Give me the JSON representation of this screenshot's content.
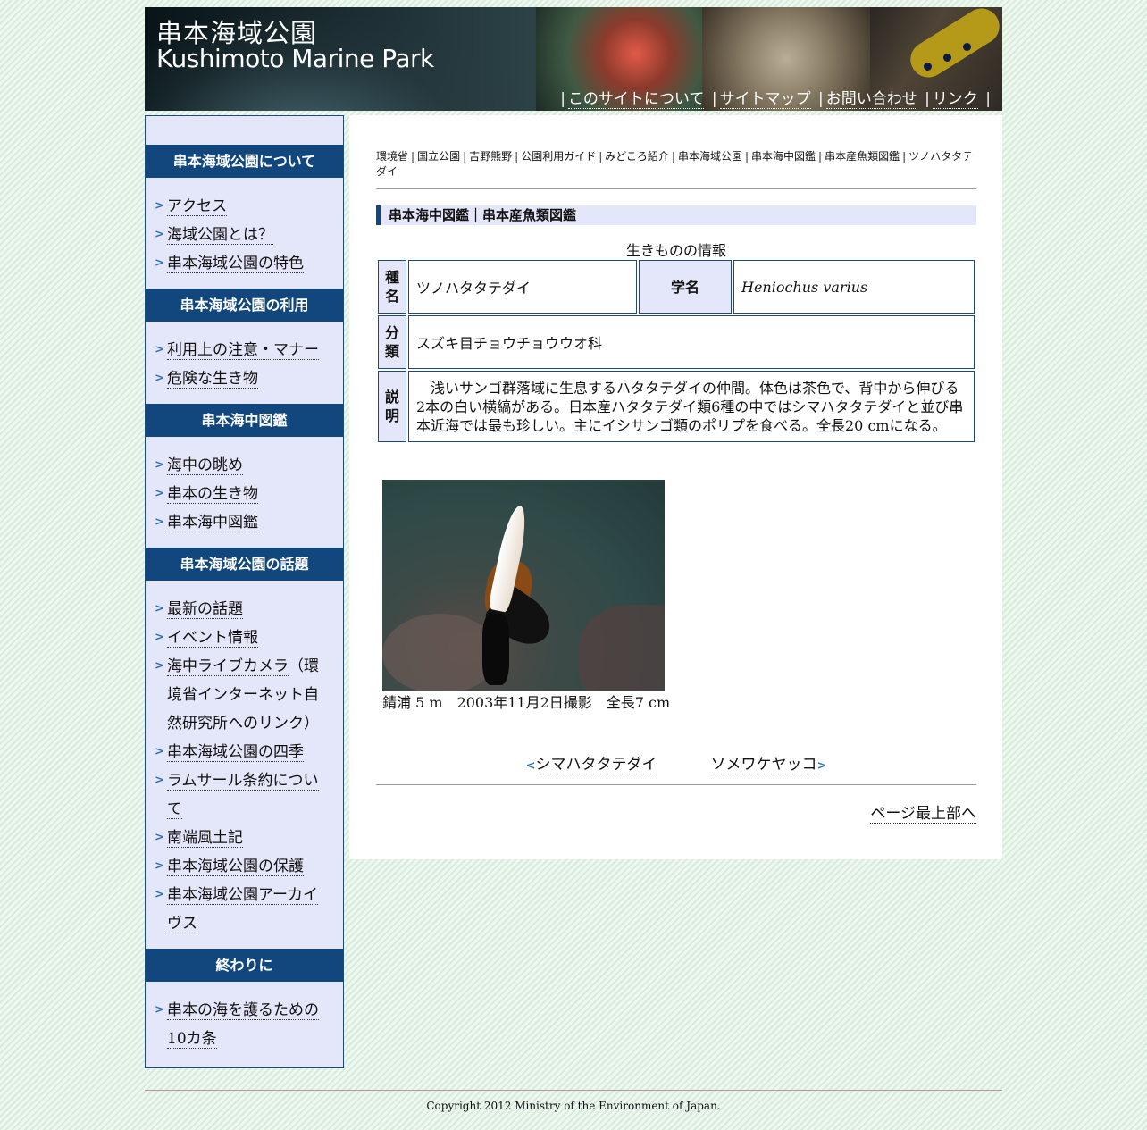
{
  "header": {
    "title_ja": "串本海域公園",
    "title_en": "Kushimoto Marine Park",
    "nav": [
      "このサイトについて",
      "サイトマップ",
      "お問い合わせ",
      "リンク"
    ]
  },
  "sidebar": {
    "sections": [
      {
        "title": "串本海域公園について",
        "items": [
          "アクセス",
          "海域公園とは？",
          "串本海域公園の特色"
        ]
      },
      {
        "title": "串本海域公園の利用",
        "items": [
          "利用上の注意・マナー",
          "危険な生き物"
        ]
      },
      {
        "title": "串本海中図鑑",
        "items": [
          "海中の眺め",
          "串本の生き物",
          "串本海中図鑑"
        ]
      },
      {
        "title": "串本海域公園の話題",
        "items": [
          "最新の話題",
          "イベント情報",
          "海中ライブカメラ",
          "串本海域公園の四季",
          "ラムサール条約について",
          "南端風土記",
          "串本海域公園の保護",
          "串本海域公園アーカイヴス"
        ],
        "live_camera_note": "（環境省インターネット自然研究所へのリンク）"
      },
      {
        "title": "終わりに",
        "items": [
          "串本の海を護るための10カ条"
        ]
      }
    ]
  },
  "breadcrumb": [
    "環境省",
    "国立公園",
    "吉野熊野",
    "公園利用ガイド",
    "みどころ紹介",
    "串本海域公園",
    "串本海中図鑑",
    "串本産魚類図鑑",
    "ツノハタタテダイ"
  ],
  "section_title": "串本海中図鑑｜串本産魚類図鑑",
  "info": {
    "caption": "生きものの情報",
    "species_label": "種名",
    "species": "ツノハタタテダイ",
    "sci_label": "学名",
    "scientific_name": "Heniochus varius",
    "family_label": "分類",
    "family": "スズキ目チョウチョウウオ科",
    "desc_label": "説明",
    "description": "　浅いサンゴ群落域に生息するハタタテダイの仲間。体色は茶色で、背中から伸びる2本の白い横縞がある。日本産ハタタテダイ類6種の中ではシマハタタテダイと並び串本近海では最も珍しい。主にイシサンゴ類のポリプを食べる。全長20 cmになる。"
  },
  "photo_caption": "錆浦 5 m　2003年11月2日撮影　全長7 cm",
  "pager": {
    "prev_arrow": "<",
    "prev": "シマハタタテダイ",
    "next": "ソメワケヤッコ",
    "next_arrow": ">"
  },
  "to_top": "ページ最上部へ",
  "footer": {
    "copyright": "Copyright 2012 Ministry of the Environment of Japan."
  }
}
